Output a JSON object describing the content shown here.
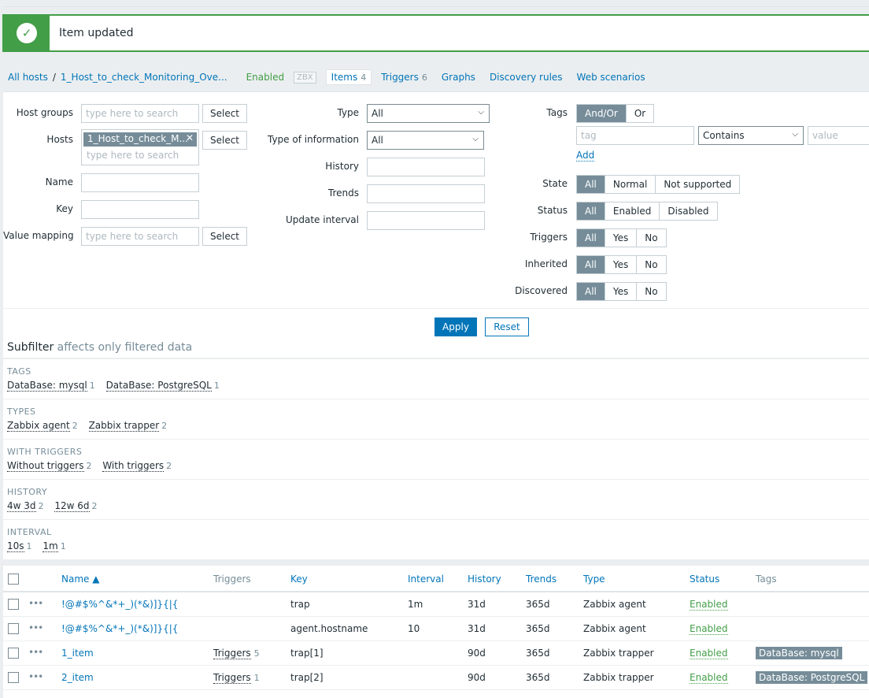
{
  "message": {
    "text": "Item updated",
    "icon": "check-icon"
  },
  "nav": {
    "all_hosts": "All hosts",
    "sep": "/",
    "host": "1_Host_to_check_Monitoring_Ove...",
    "enabled": "Enabled",
    "zbx": "ZBX",
    "items_label": "Items",
    "items_count": "4",
    "triggers_label": "Triggers",
    "triggers_count": "6",
    "graphs": "Graphs",
    "discovery": "Discovery rules",
    "web": "Web scenarios"
  },
  "filter": {
    "host_groups_label": "Host groups",
    "host_groups_placeholder": "type here to search",
    "hosts_label": "Hosts",
    "hosts_chip": "1_Host_to_check_M...",
    "hosts_chip_close": "✕",
    "hosts_placeholder": "type here to search",
    "name_label": "Name",
    "key_label": "Key",
    "value_mapping_label": "Value mapping",
    "value_mapping_placeholder": "type here to search",
    "select": "Select",
    "type_label": "Type",
    "type_value": "All",
    "type_info_label": "Type of information",
    "type_info_value": "All",
    "history_label": "History",
    "trends_label": "Trends",
    "update_interval_label": "Update interval",
    "tags_label": "Tags",
    "tags_andor": "And/Or",
    "tags_or": "Or",
    "tag_placeholder": "tag",
    "tag_operator": "Contains",
    "value_placeholder": "value",
    "add": "Add",
    "state_label": "State",
    "state_options": [
      "All",
      "Normal",
      "Not supported"
    ],
    "status_label": "Status",
    "status_options": [
      "All",
      "Enabled",
      "Disabled"
    ],
    "triggers_label": "Triggers",
    "inherited_label": "Inherited",
    "discovered_label": "Discovered",
    "yes_no": [
      "All",
      "Yes",
      "No"
    ],
    "apply": "Apply",
    "reset": "Reset"
  },
  "subfilter": {
    "title": "Subfilter",
    "subtitle": "affects only filtered data",
    "tags_title": "TAGS",
    "tags": [
      {
        "label": "DataBase: mysql",
        "count": "1"
      },
      {
        "label": "DataBase: PostgreSQL",
        "count": "1"
      }
    ],
    "types_title": "TYPES",
    "types": [
      {
        "label": "Zabbix agent",
        "count": "2"
      },
      {
        "label": "Zabbix trapper",
        "count": "2"
      }
    ],
    "with_triggers_title": "WITH TRIGGERS",
    "with_triggers": [
      {
        "label": "Without triggers",
        "count": "2"
      },
      {
        "label": "With triggers",
        "count": "2"
      }
    ],
    "history_title": "HISTORY",
    "history": [
      {
        "label": "4w 3d",
        "count": "2"
      },
      {
        "label": "12w 6d",
        "count": "2"
      }
    ],
    "interval_title": "INTERVAL",
    "interval": [
      {
        "label": "10s",
        "count": "1"
      },
      {
        "label": "1m",
        "count": "1"
      }
    ]
  },
  "table": {
    "headers": {
      "name": "Name ▲",
      "triggers": "Triggers",
      "key": "Key",
      "interval": "Interval",
      "history": "History",
      "trends": "Trends",
      "type": "Type",
      "status": "Status",
      "tags": "Tags"
    },
    "rows": [
      {
        "dots": "•••",
        "name": "!@#$%^&*+_)(*&)]}{|{",
        "triggers": "",
        "triggers_count": "",
        "key": "trap",
        "interval": "1m",
        "history": "31d",
        "trends": "365d",
        "type": "Zabbix agent",
        "status": "Enabled",
        "tag": ""
      },
      {
        "dots": "•••",
        "name": "!@#$%^&*+_)(*&)]}{|{",
        "triggers": "",
        "triggers_count": "",
        "key": "agent.hostname",
        "interval": "10",
        "history": "31d",
        "trends": "365d",
        "type": "Zabbix agent",
        "status": "Enabled",
        "tag": ""
      },
      {
        "dots": "•••",
        "name": "1_item",
        "triggers": "Triggers",
        "triggers_count": "5",
        "key": "trap[1]",
        "interval": "",
        "history": "90d",
        "trends": "365d",
        "type": "Zabbix trapper",
        "status": "Enabled",
        "tag": "DataBase: mysql"
      },
      {
        "dots": "•••",
        "name": "2_item",
        "triggers": "Triggers",
        "triggers_count": "1",
        "key": "trap[2]",
        "interval": "",
        "history": "90d",
        "trends": "365d",
        "type": "Zabbix trapper",
        "status": "Enabled",
        "tag": "DataBase: PostgreSQL"
      }
    ]
  },
  "colors": {
    "accent": "#0275b8",
    "success": "#429e47",
    "chip": "#768d99"
  }
}
